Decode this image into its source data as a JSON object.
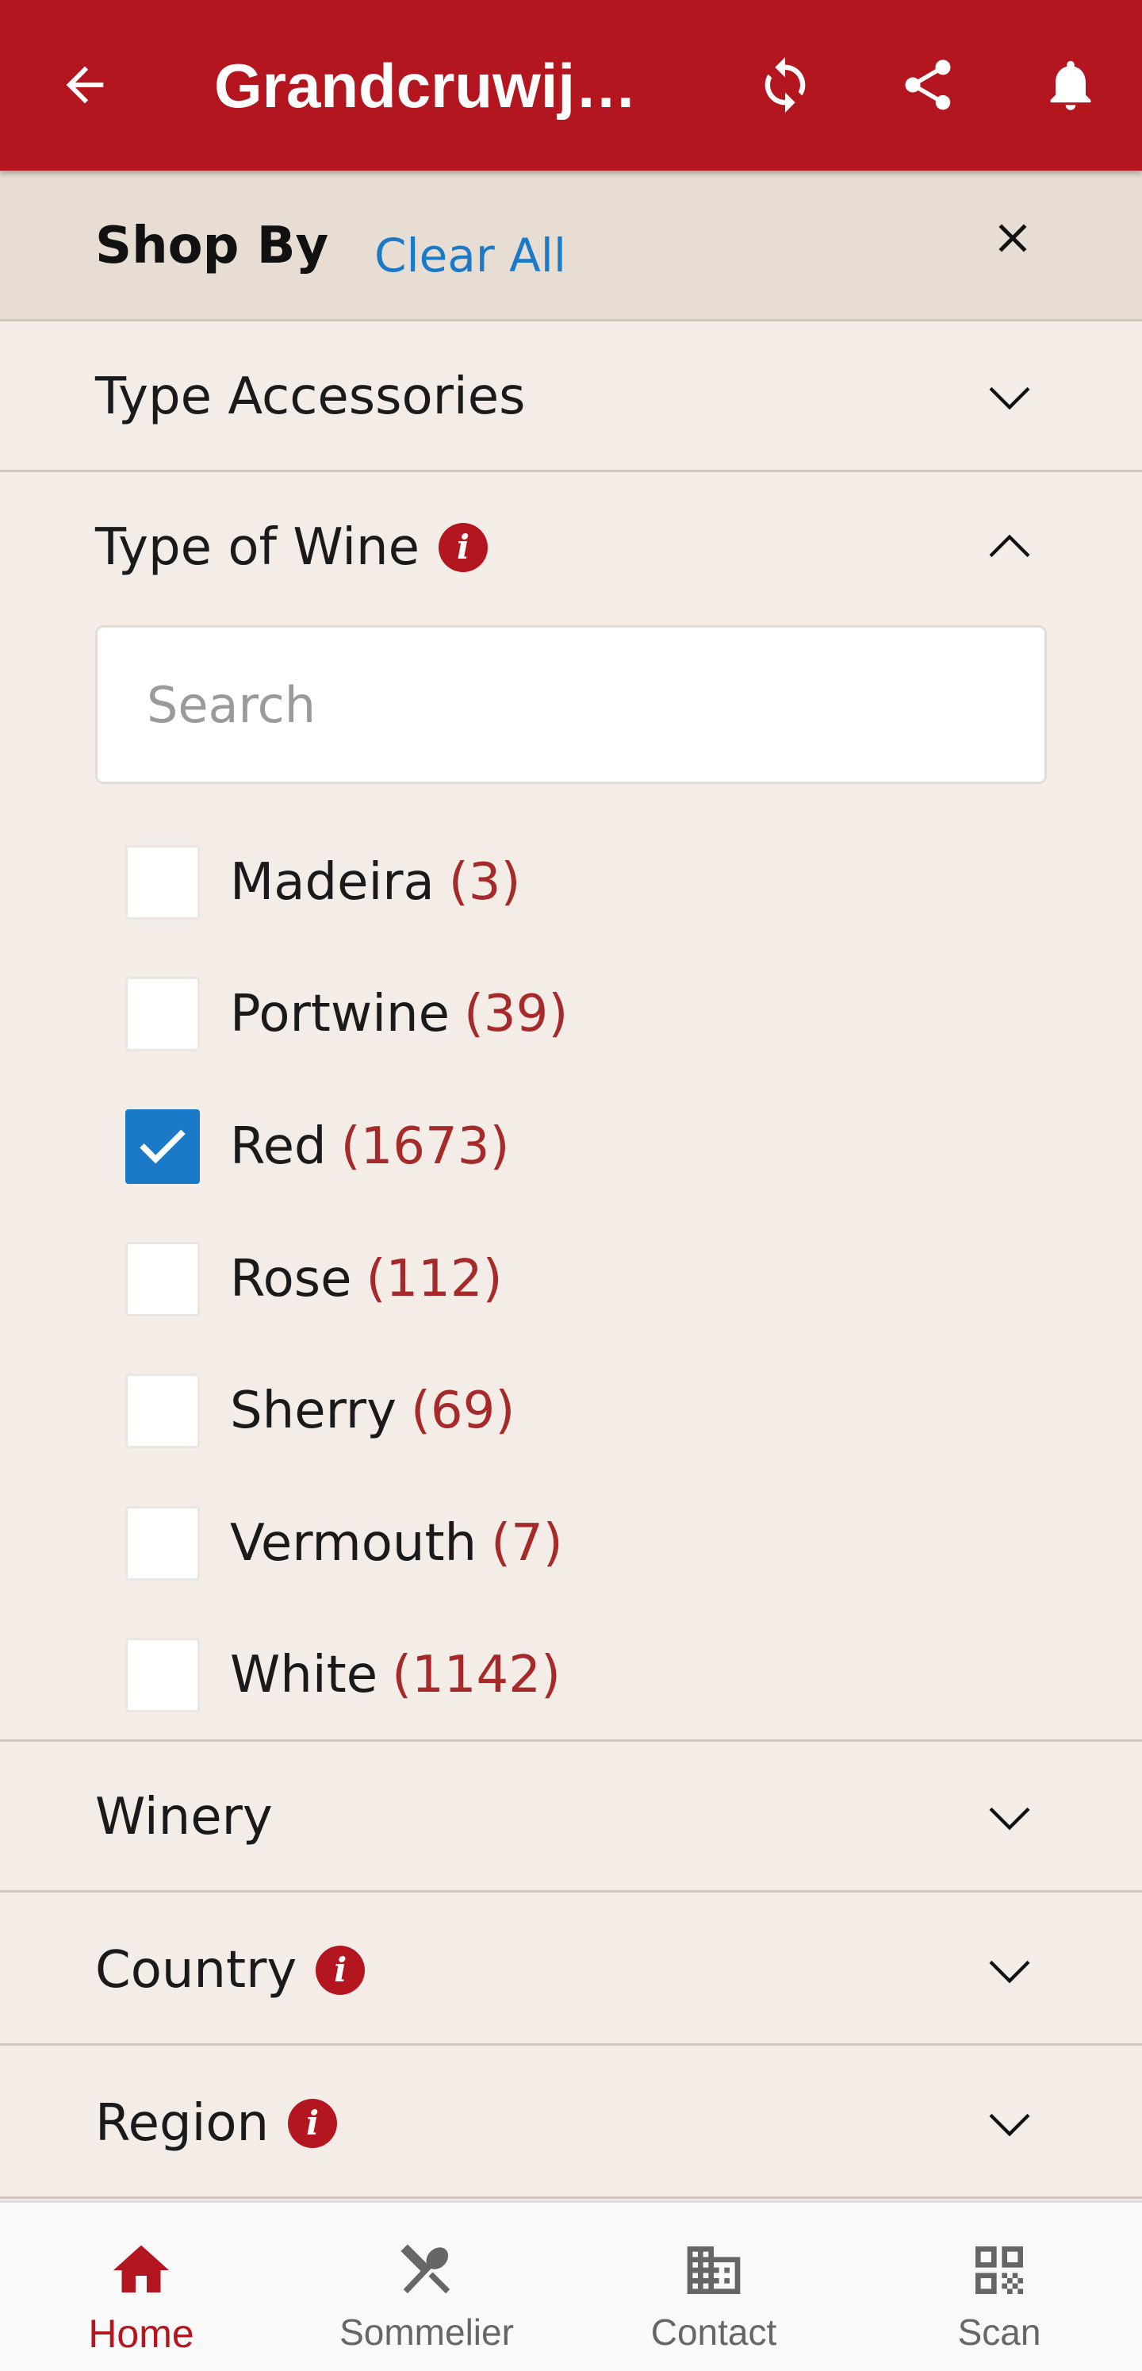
{
  "app_bar": {
    "title": "Grandcruwijnen",
    "icons": [
      "back-arrow-icon",
      "refresh-icon",
      "share-icon",
      "bell-icon"
    ]
  },
  "shop_by": {
    "label": "Shop By",
    "clear_all": "Clear All"
  },
  "filters": {
    "type_accessories": "Type Accessories",
    "type_of_wine": {
      "label": "Type of Wine",
      "search_placeholder": "Search",
      "options": [
        {
          "label": "Madeira",
          "count": "(3)",
          "checked": false
        },
        {
          "label": "Portwine",
          "count": "(39)",
          "checked": false
        },
        {
          "label": "Red",
          "count": "(1673)",
          "checked": true
        },
        {
          "label": "Rose",
          "count": "(112)",
          "checked": false
        },
        {
          "label": "Sherry",
          "count": "(69)",
          "checked": false
        },
        {
          "label": "Vermouth",
          "count": "(7)",
          "checked": false
        },
        {
          "label": "White",
          "count": "(1142)",
          "checked": false
        }
      ]
    },
    "winery": "Winery",
    "country": "Country",
    "region": "Region"
  },
  "bottom_nav": {
    "home": "Home",
    "sommelier": "Sommelier",
    "contact": "Contact",
    "scan": "Scan",
    "active": "home"
  },
  "colors": {
    "brand_red": "#b3161f",
    "link_blue": "#1a7ac8",
    "background": "#f3ece7",
    "header_bg": "#e7ddd2"
  }
}
